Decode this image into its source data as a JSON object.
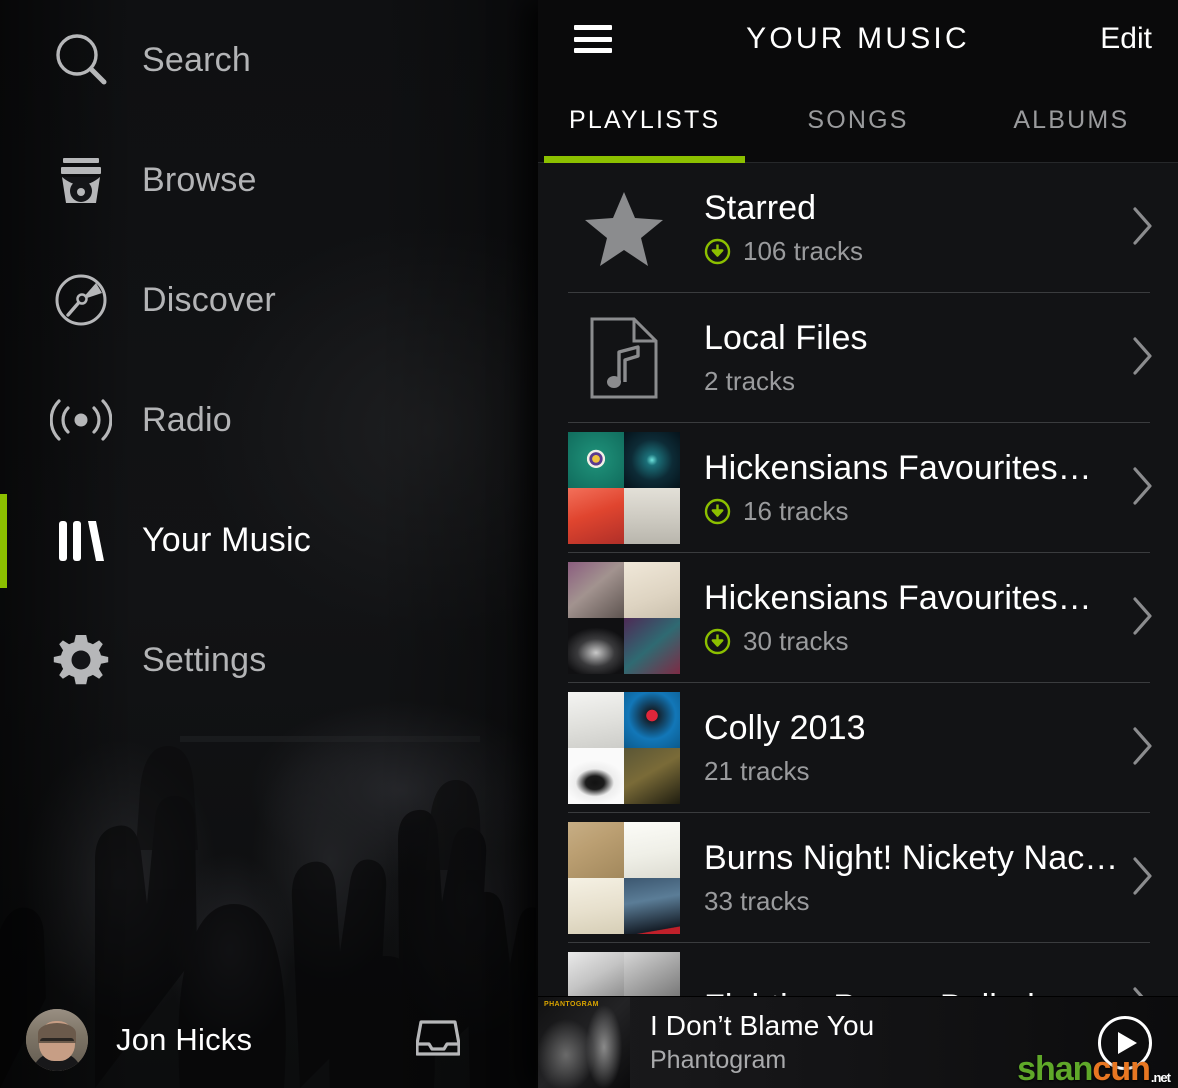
{
  "colors": {
    "accent_green": "#8cc000",
    "panel_bg": "#121315",
    "header_bg": "#0a0a0b",
    "text_primary": "#ffffff",
    "text_secondary": "#9a9b9d",
    "divider": "#3a3c3e"
  },
  "sidebar": {
    "items": [
      {
        "label": "Search",
        "icon": "search-icon",
        "active": false
      },
      {
        "label": "Browse",
        "icon": "browse-icon",
        "active": false
      },
      {
        "label": "Discover",
        "icon": "discover-icon",
        "active": false
      },
      {
        "label": "Radio",
        "icon": "radio-icon",
        "active": false
      },
      {
        "label": "Your Music",
        "icon": "your-music-icon",
        "active": true
      },
      {
        "label": "Settings",
        "icon": "settings-icon",
        "active": false
      }
    ],
    "user": {
      "name": "Jon Hicks",
      "avatar": "user-avatar",
      "inbox_icon": "inbox-icon"
    }
  },
  "header": {
    "menu_icon": "hamburger-icon",
    "title": "YOUR MUSIC",
    "edit_label": "Edit"
  },
  "tabs": [
    {
      "label": "PLAYLISTS",
      "active": true
    },
    {
      "label": "SONGS",
      "active": false
    },
    {
      "label": "ALBUMS",
      "active": false
    }
  ],
  "playlists": [
    {
      "title": "Starred",
      "tracks": "106 tracks",
      "downloaded": true,
      "art_type": "star-icon",
      "tiles": []
    },
    {
      "title": "Local Files",
      "tracks": "2 tracks",
      "downloaded": false,
      "art_type": "local-file-icon",
      "tiles": []
    },
    {
      "title": "Hickensians Favourites…",
      "tracks": "16 tracks",
      "downloaded": true,
      "art_type": "mosaic",
      "tiles": [
        "linear-gradient(135deg,#0e6b5e 0%,#127a66 40%,#1f4e49 100%)",
        "radial-gradient(circle at 52% 48%, #3fc7c7 0%, #14ararar 1%, #0c2b33 45%, #06131a 100%)",
        "linear-gradient(160deg,#e8583c 0%,#d2402e 45%,#a8332b 100%)",
        "linear-gradient(180deg,#dcd9d2 0%,#c9c5bd 55%,#b6b2aa 100%)"
      ]
    },
    {
      "title": "Hickensians Favourites…",
      "tracks": "30 tracks",
      "downloaded": true,
      "art_type": "mosaic",
      "tiles": [
        "linear-gradient(140deg,#6b4a6e 0%,#8d7b84 45%,#5c5350 100%)",
        "linear-gradient(160deg,#ece4d6 0%,#ddd3c2 60%,#c9bfae 100%)",
        "linear-gradient(150deg,#1a1a1c 0%,#3a3a3c 55%,#151517 100%)",
        "linear-gradient(140deg,#4a2a52 0%,#2f6a72 50%,#7a2c44 100%)"
      ]
    },
    {
      "title": "Colly 2013",
      "tracks": "21 tracks",
      "downloaded": false,
      "art_type": "mosaic",
      "tiles": [
        "linear-gradient(170deg,#f2f2f0 0%,#e2e2df 55%,#d2d2cf 100%)",
        "linear-gradient(150deg,#1277b8 0%,#0f6aa6 55%,#0b5585 100%)",
        "linear-gradient(170deg,#f6f6f6 0%,#cfcfcf 50%,#4a4a4a 100%)",
        "linear-gradient(150deg,#4a4a30 0%,#6b5f33 50%,#22200f 100%)"
      ]
    },
    {
      "title": "Burns Night! Nickety Nac…",
      "tracks": "33 tracks",
      "downloaded": false,
      "art_type": "mosaic",
      "tiles": [
        "linear-gradient(150deg,#c2a87e 0%,#b59a6d 55%,#9e8458 100%)",
        "linear-gradient(170deg,#fbfbf7 0%,#eeeee6 55%,#dcdcd2 100%)",
        "linear-gradient(170deg,#f3efe2 0%,#e6dfcc 55%,#d4ccb4 100%)",
        "linear-gradient(160deg,#2b3d52 0%,#46627d 45%,#17202c 100%)"
      ]
    },
    {
      "title": "Fighties Power Ballads",
      "tracks": "",
      "downloaded": false,
      "art_type": "mosaic",
      "tiles": [
        "linear-gradient(150deg,#ececec 0%,#c8c8c8 50%,#8c8c8c 100%)",
        "linear-gradient(150deg,#d8d8d8 0%,#a5a5a5 50%,#6d6d6d 100%)",
        "linear-gradient(150deg,#e0e0e0 0%,#b0b0b0 50%,#767676 100%)",
        "linear-gradient(150deg,#cfcfcf 0%,#9a9a9a 50%,#5f5f5f 100%)"
      ]
    }
  ],
  "now_playing": {
    "title": "I Don’t Blame You",
    "artist": "Phantogram",
    "album_label": "PHANTOGRAM",
    "play_icon": "play-icon"
  },
  "watermark": {
    "part_green": "shan",
    "part_orange": "cun",
    "tld": ".net"
  }
}
